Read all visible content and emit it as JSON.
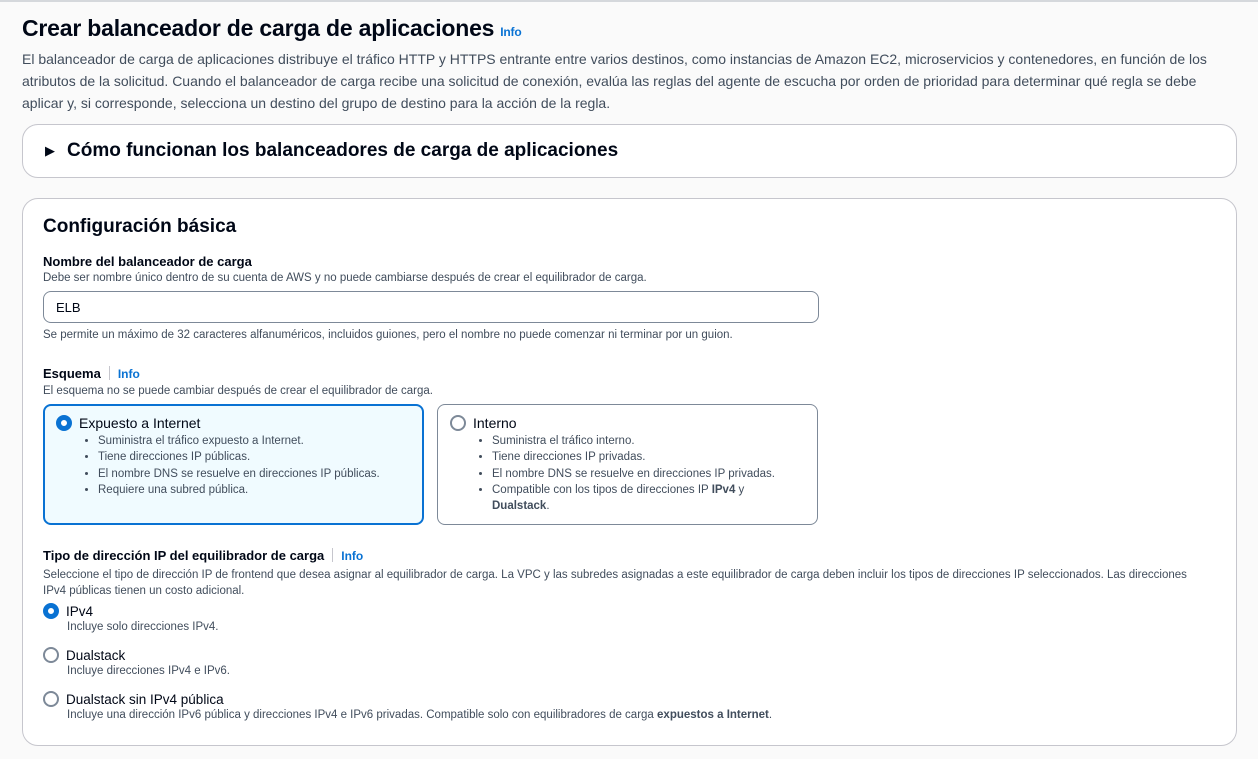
{
  "title": "Crear balanceador de carga de aplicaciones",
  "info": "Info",
  "description": "El balanceador de carga de aplicaciones distribuye el tráfico HTTP y HTTPS entrante entre varios destinos, como instancias de Amazon EC2, microservicios y contenedores, en función de los atributos de la solicitud. Cuando el balanceador de carga recibe una solicitud de conexión, evalúa las reglas del agente de escucha por orden de prioridad para determinar qué regla se debe aplicar y, si corresponde, selecciona un destino del grupo de destino para la acción de la regla.",
  "expander": "Cómo funcionan los balanceadores de carga de aplicaciones",
  "basic": {
    "title": "Configuración básica",
    "name_label": "Nombre del balanceador de carga",
    "name_desc": "Debe ser nombre único dentro de su cuenta de AWS y no puede cambiarse después de crear el equilibrador de carga.",
    "name_value": "ELB",
    "name_constraint": "Se permite un máximo de 32 caracteres alfanuméricos, incluidos guiones, pero el nombre no puede comenzar ni terminar por un guion.",
    "scheme_label": "Esquema",
    "scheme_desc": "El esquema no se puede cambiar después de crear el equilibrador de carga.",
    "scheme_options": [
      {
        "label": "Expuesto a Internet",
        "selected": true,
        "bullets": [
          "Suministra el tráfico expuesto a Internet.",
          "Tiene direcciones IP públicas.",
          "El nombre DNS se resuelve en direcciones IP públicas.",
          "Requiere una subred pública."
        ]
      },
      {
        "label": "Interno",
        "selected": false,
        "bullets": [
          "Suministra el tráfico interno.",
          "Tiene direcciones IP privadas.",
          "El nombre DNS se resuelve en direcciones IP privadas."
        ],
        "last_pre": "Compatible con los tipos de direcciones IP ",
        "last_b1": "IPv4",
        "last_mid": " y ",
        "last_b2": "Dualstack",
        "last_end": "."
      }
    ],
    "ip_label": "Tipo de dirección IP del equilibrador de carga",
    "ip_desc": "Seleccione el tipo de dirección IP de frontend que desea asignar al equilibrador de carga. La VPC y las subredes asignadas a este equilibrador de carga deben incluir los tipos de direcciones IP seleccionados. Las direcciones IPv4 públicas tienen un costo adicional.",
    "ip_options": [
      {
        "label": "IPv4",
        "desc": "Incluye solo direcciones IPv4.",
        "selected": true
      },
      {
        "label": "Dualstack",
        "desc": "Incluye direcciones IPv4 e IPv6.",
        "selected": false
      },
      {
        "label": "Dualstack sin IPv4 pública",
        "desc": "Incluye una dirección IPv6 pública y direcciones IPv4 e IPv6 privadas. Compatible solo con equilibradores de carga ",
        "desc_bold": "expuestos a Internet",
        "desc_end": ".",
        "selected": false
      }
    ]
  }
}
